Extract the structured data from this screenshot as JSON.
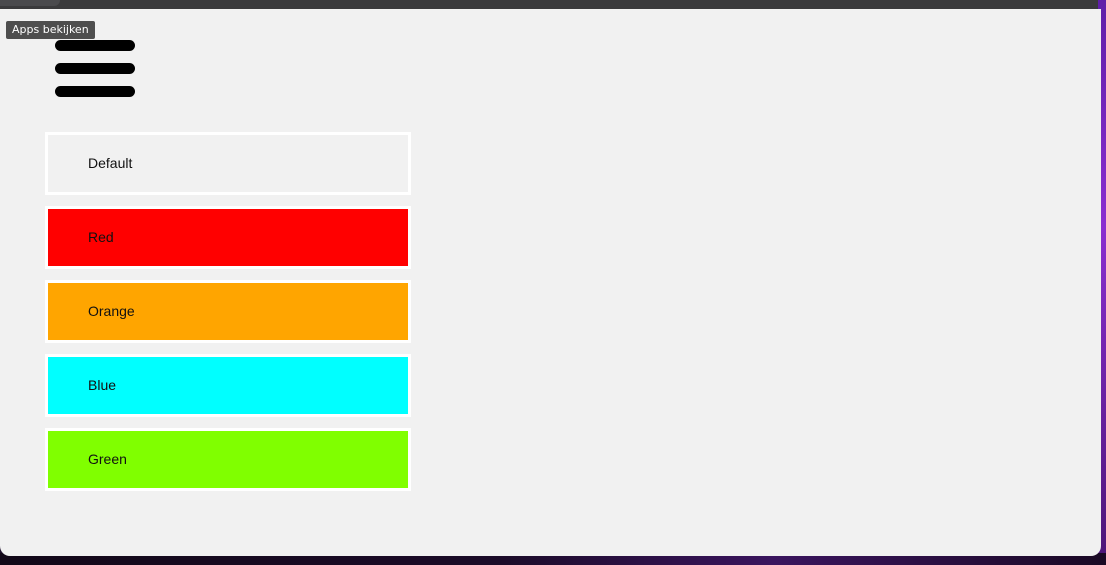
{
  "tooltip": {
    "text": "Apps bekijken"
  },
  "menu": {
    "icon": "hamburger-menu-icon"
  },
  "colors": [
    {
      "label": "Default",
      "color": "#f1f1f1"
    },
    {
      "label": "Red",
      "color": "#ff0000"
    },
    {
      "label": "Orange",
      "color": "#ffa500"
    },
    {
      "label": "Blue",
      "color": "#00ffff"
    },
    {
      "label": "Green",
      "color": "#80ff00"
    }
  ]
}
